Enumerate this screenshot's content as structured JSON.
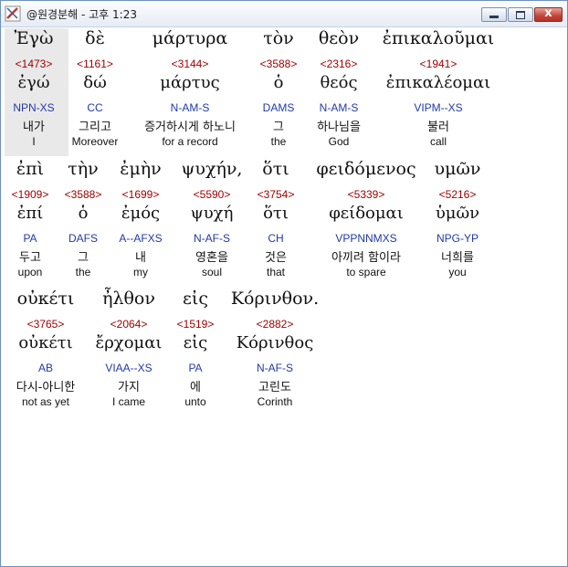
{
  "window": {
    "title": "@원경분해 - 고후 1:23",
    "close_label": "x"
  },
  "lines": [
    {
      "words": [
        {
          "greek": "Ἐγὼ",
          "strong": "<1473>",
          "lexeme": "ἐγώ",
          "parsing": "NPN-XS",
          "korean": "내가",
          "english": "I"
        },
        {
          "greek": "δὲ",
          "strong": "<1161>",
          "lexeme": "δώ",
          "parsing": "CC",
          "korean": "그리고",
          "english": "Moreover"
        },
        {
          "greek": "μάρτυρα",
          "strong": "<3144>",
          "lexeme": "μάρτυς",
          "parsing": "N-AM-S",
          "korean": "증거하시게 하노니",
          "english": "for a record"
        },
        {
          "greek": "τὸν",
          "strong": "<3588>",
          "lexeme": "ὁ",
          "parsing": "DAMS",
          "korean": "그",
          "english": "the"
        },
        {
          "greek": "θεὸν",
          "strong": "<2316>",
          "lexeme": "θεός",
          "parsing": "N-AM-S",
          "korean": "하나님을",
          "english": "God"
        },
        {
          "greek": "ἐπικαλοῦμαι",
          "strong": "<1941>",
          "lexeme": "ἐπικαλέομαι",
          "parsing": "VIPM--XS",
          "korean": "불러",
          "english": "call"
        }
      ]
    },
    {
      "words": [
        {
          "greek": "ἐπὶ",
          "strong": "<1909>",
          "lexeme": "ἐπί",
          "parsing": "PA",
          "korean": "두고",
          "english": "upon"
        },
        {
          "greek": "τὴν",
          "strong": "<3588>",
          "lexeme": "ὁ",
          "parsing": "DAFS",
          "korean": "그",
          "english": "the"
        },
        {
          "greek": "ἐμὴν",
          "strong": "<1699>",
          "lexeme": "ἐμός",
          "parsing": "A--AFXS",
          "korean": "내",
          "english": "my"
        },
        {
          "greek": "ψυχήν,",
          "strong": "<5590>",
          "lexeme": "ψυχή",
          "parsing": "N-AF-S",
          "korean": "영혼을",
          "english": "soul"
        },
        {
          "greek": "ὅτι",
          "strong": "<3754>",
          "lexeme": "ὅτι",
          "parsing": "CH",
          "korean": "것은",
          "english": "that"
        },
        {
          "greek": "φειδόμενος",
          "strong": "<5339>",
          "lexeme": "φείδομαι",
          "parsing": "VPPNNMXS",
          "korean": "아끼려 함이라",
          "english": "to spare"
        },
        {
          "greek": "υμῶν",
          "strong": "<5216>",
          "lexeme": "ὑμῶν",
          "parsing": "NPG-YP",
          "korean": "너희를",
          "english": "you"
        }
      ]
    },
    {
      "words": [
        {
          "greek": "οὐκέτι",
          "strong": "<3765>",
          "lexeme": "οὐκέτι",
          "parsing": "AB",
          "korean": "다시-아니한",
          "english": "not as yet"
        },
        {
          "greek": "ἦλθον",
          "strong": "<2064>",
          "lexeme": "ἔρχομαι",
          "parsing": "VIAA--XS",
          "korean": "가지",
          "english": "I came"
        },
        {
          "greek": "εἰς",
          "strong": "<1519>",
          "lexeme": "εἰς",
          "parsing": "PA",
          "korean": "에",
          "english": "unto"
        },
        {
          "greek": "Κόρινθον.",
          "strong": "<2882>",
          "lexeme": "Κόρινθος",
          "parsing": "N-AF-S",
          "korean": "고린도",
          "english": "Corinth"
        }
      ]
    }
  ]
}
